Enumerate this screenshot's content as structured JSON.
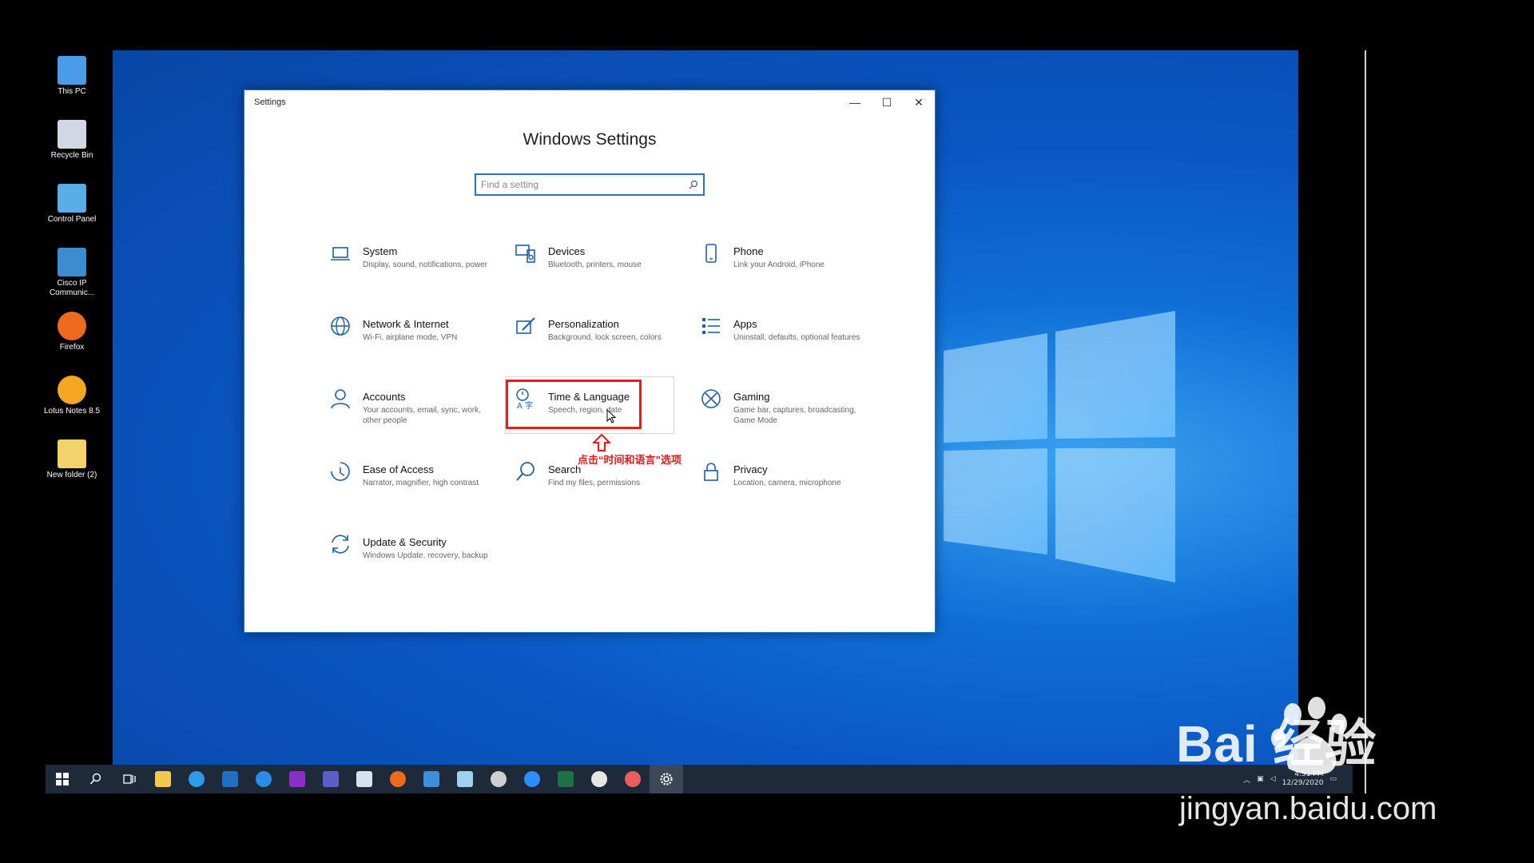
{
  "desktop_icons": [
    {
      "label": "This PC",
      "icon": "computer-icon",
      "color": "#4a9be8"
    },
    {
      "label": "Recycle Bin",
      "icon": "recycle-bin-icon",
      "color": "#cfd8e3"
    },
    {
      "label": "Control Panel",
      "icon": "control-panel-icon",
      "color": "#5aaee8"
    },
    {
      "label": "Cisco IP Communic...",
      "icon": "cisco-ip-communicator-icon",
      "color": "#3c8dd0"
    },
    {
      "label": "Firefox",
      "icon": "firefox-icon",
      "color": "#f06a1d"
    },
    {
      "label": "Lotus Notes 8.5",
      "icon": "lotus-notes-icon",
      "color": "#f5a623"
    },
    {
      "label": "New folder (2)",
      "icon": "folder-icon",
      "color": "#f2d26b"
    }
  ],
  "window": {
    "title": "Settings",
    "heading": "Windows Settings",
    "minimize": "—",
    "maximize": "☐",
    "close": "✕"
  },
  "search": {
    "placeholder": "Find a setting",
    "icon": "search-icon"
  },
  "tiles": [
    {
      "title": "System",
      "desc": "Display, sound, notifications, power",
      "icon": "laptop-icon"
    },
    {
      "title": "Devices",
      "desc": "Bluetooth, printers, mouse",
      "icon": "keyboard-speaker-icon"
    },
    {
      "title": "Phone",
      "desc": "Link your Android, iPhone",
      "icon": "phone-icon"
    },
    {
      "title": "Network & Internet",
      "desc": "Wi-Fi, airplane mode, VPN",
      "icon": "globe-icon"
    },
    {
      "title": "Personalization",
      "desc": "Background, lock screen, colors",
      "icon": "paint-pen-icon"
    },
    {
      "title": "Apps",
      "desc": "Uninstall, defaults, optional features",
      "icon": "apps-list-icon"
    },
    {
      "title": "Accounts",
      "desc": "Your accounts, email, sync, work, other people",
      "icon": "person-icon"
    },
    {
      "title": "Time & Language",
      "desc": "Speech, region, date",
      "icon": "time-language-icon"
    },
    {
      "title": "Gaming",
      "desc": "Game bar, captures, broadcasting, Game Mode",
      "icon": "xbox-icon"
    },
    {
      "title": "Ease of Access",
      "desc": "Narrator, magnifier, high contrast",
      "icon": "ease-of-access-icon"
    },
    {
      "title": "Search",
      "desc": "Find my files, permissions",
      "icon": "magnifier-icon"
    },
    {
      "title": "Privacy",
      "desc": "Location, camera, microphone",
      "icon": "lock-icon"
    },
    {
      "title": "Update & Security",
      "desc": "Windows Update, recovery, backup",
      "icon": "sync-arrows-icon"
    }
  ],
  "annotation": {
    "text": "点击“时间和语言”选项",
    "color": "#e01b1b"
  },
  "taskbar": {
    "items": [
      {
        "icon": "start-icon",
        "color": "#ffffff"
      },
      {
        "icon": "search-icon",
        "color": "#ffffff"
      },
      {
        "icon": "task-view-icon",
        "color": "#ffffff"
      },
      {
        "icon": "file-explorer-icon",
        "color": "#f2c94c"
      },
      {
        "icon": "internet-explorer-icon",
        "color": "#2d9be8"
      },
      {
        "icon": "outlook-icon",
        "color": "#1f6fc5"
      },
      {
        "icon": "edge-icon",
        "color": "#2d8ce8"
      },
      {
        "icon": "onenote-icon",
        "color": "#8a2fc4"
      },
      {
        "icon": "teams-icon",
        "color": "#5b5fc7"
      },
      {
        "icon": "remote-desktop-icon",
        "color": "#d8e2ef"
      },
      {
        "icon": "firefox-icon",
        "color": "#f06a1d"
      },
      {
        "icon": "contacts-icon",
        "color": "#3f8fd8"
      },
      {
        "icon": "notepad-icon",
        "color": "#9fd0f0"
      },
      {
        "icon": "app-spiral-icon",
        "color": "#cfcfcf"
      },
      {
        "icon": "zoom-icon",
        "color": "#2d8cff"
      },
      {
        "icon": "excel-icon",
        "color": "#1e7145"
      },
      {
        "icon": "paint-icon",
        "color": "#e6e6e6"
      },
      {
        "icon": "snipping-icon",
        "color": "#e85d5d"
      },
      {
        "icon": "settings-gear-icon",
        "color": "#ffffff"
      }
    ],
    "tray": {
      "time": "4:51 PM",
      "date": "12/29/2020"
    }
  },
  "watermark": {
    "brand": "Bai 经验",
    "url": "jingyan.baidu.com"
  }
}
